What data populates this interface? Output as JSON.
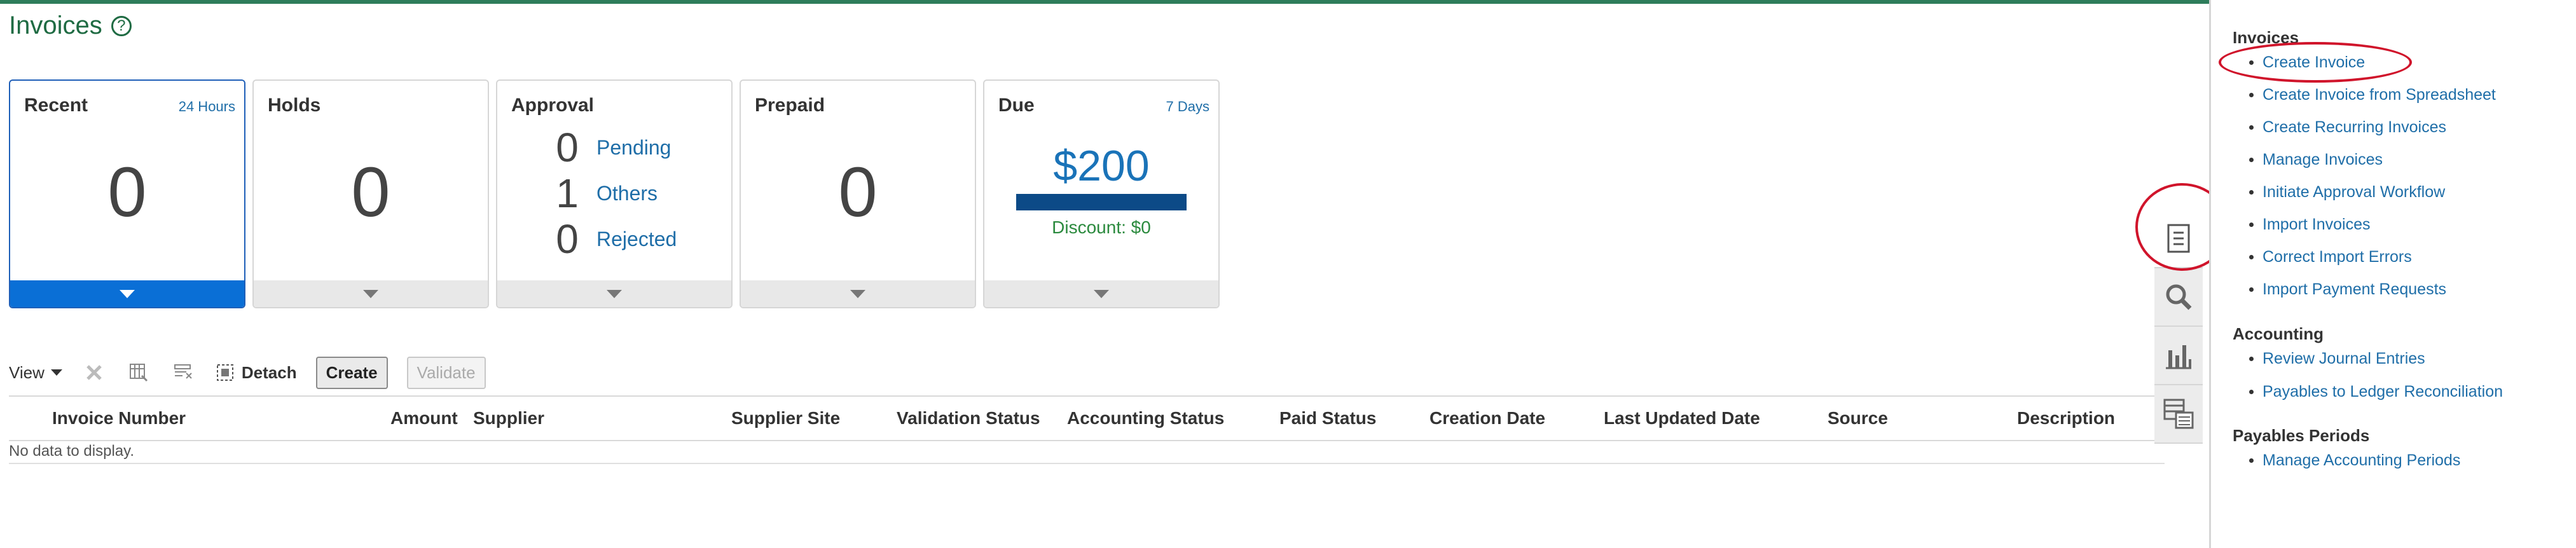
{
  "page": {
    "title": "Invoices",
    "help_icon": "question-circle-icon",
    "accent": "#1f6b43"
  },
  "tiles": {
    "recent": {
      "label": "Recent",
      "range": "24 Hours",
      "count": "0"
    },
    "holds": {
      "label": "Holds",
      "count": "0"
    },
    "approval": {
      "label": "Approval",
      "rows": [
        {
          "count": "0",
          "label": "Pending"
        },
        {
          "count": "1",
          "label": "Others"
        },
        {
          "count": "0",
          "label": "Rejected"
        }
      ]
    },
    "prepaid": {
      "label": "Prepaid",
      "count": "0"
    },
    "due": {
      "label": "Due",
      "range": "7 Days",
      "amount": "$200",
      "discount": "Discount: $0"
    }
  },
  "toolbar": {
    "view_label": "View",
    "detach_label": "Detach",
    "create_label": "Create",
    "validate_label": "Validate"
  },
  "table": {
    "columns": [
      "Invoice Number",
      "Amount",
      "Supplier",
      "Supplier Site",
      "Validation Status",
      "Accounting Status",
      "Paid Status",
      "Creation Date",
      "Last Updated Date",
      "Source",
      "Description"
    ],
    "empty_text": "No data to display."
  },
  "panel": {
    "sections": [
      {
        "title": "Invoices",
        "links": [
          "Create Invoice",
          "Create Invoice from Spreadsheet",
          "Create Recurring Invoices",
          "Manage Invoices",
          "Initiate Approval Workflow",
          "Import Invoices",
          "Correct Import Errors",
          "Import Payment Requests"
        ]
      },
      {
        "title": "Accounting",
        "links": [
          "Review Journal Entries",
          "Payables to Ledger Reconciliation"
        ]
      },
      {
        "title": "Payables Periods",
        "links": [
          "Manage Accounting Periods"
        ]
      }
    ]
  },
  "strip_icons": [
    "tasks-icon",
    "search-icon",
    "bar-chart-icon",
    "reports-icon"
  ],
  "colors": {
    "link": "#1f6ea8",
    "selected": "#0a6fd6",
    "due_bar": "#0c4a87",
    "highlight": "#d0142b"
  }
}
